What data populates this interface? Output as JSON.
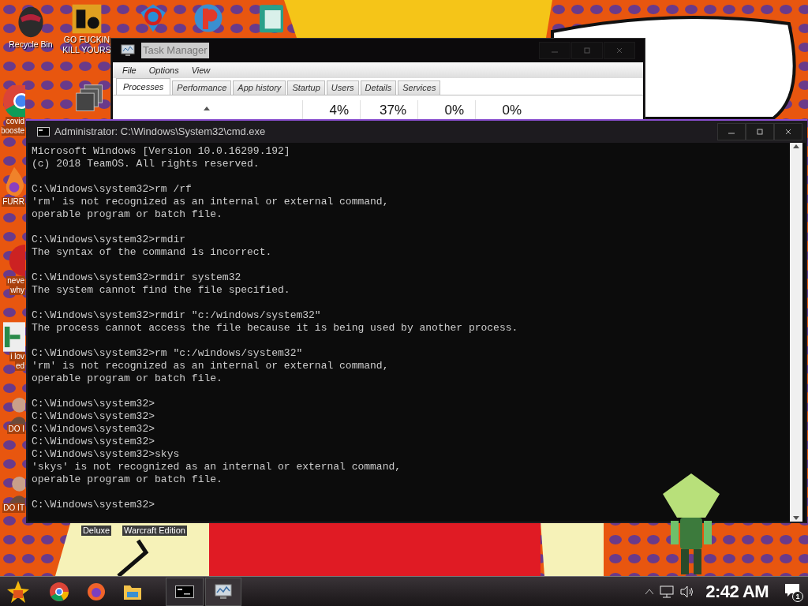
{
  "desktop_icons": [
    {
      "kind": "bin",
      "label_lines": [
        "Recycle Bin"
      ]
    },
    {
      "kind": "de",
      "label_lines": [
        "GO FUCKIN",
        "KILL YOURS"
      ]
    },
    {
      "kind": "gem"
    },
    {
      "kind": "p"
    },
    {
      "kind": "doc"
    },
    {
      "kind": "chrome",
      "label_lines": [
        "covid",
        "booste"
      ]
    },
    {
      "kind": "stack"
    },
    {
      "kind": "fox",
      "label_lines": [
        "FURR"
      ]
    },
    {
      "kind": "dc",
      "label_lines": [
        "neve",
        "why"
      ]
    },
    {
      "kind": "h",
      "label_lines": [
        "i lov",
        "ed"
      ]
    },
    {
      "kind": "person",
      "label_lines": [
        "DO I"
      ]
    },
    {
      "kind": "person",
      "label_lines": [
        "DO IT"
      ]
    },
    {
      "kind": "none",
      "label_lines": [
        "Deluxe"
      ]
    },
    {
      "kind": "none",
      "label_lines": [
        "Warcraft Edition"
      ]
    }
  ],
  "task_manager": {
    "title": "Task Manager",
    "menu": [
      "File",
      "Options",
      "View"
    ],
    "tabs": [
      {
        "label": "Processes",
        "selected": true
      },
      {
        "label": "Performance",
        "selected": false
      },
      {
        "label": "App history",
        "selected": false
      },
      {
        "label": "Startup",
        "selected": false
      },
      {
        "label": "Users",
        "selected": false
      },
      {
        "label": "Details",
        "selected": false
      },
      {
        "label": "Services",
        "selected": false
      }
    ],
    "column_values": [
      "4%",
      "37%",
      "0%",
      "0%"
    ]
  },
  "cmd": {
    "title": "Administrator: C:\\Windows\\System32\\cmd.exe",
    "blocks": [
      [
        "Microsoft Windows [Version 10.0.16299.192]",
        "(c) 2018 TeamOS. All rights reserved."
      ],
      [
        "C:\\Windows\\system32>rm /rf",
        "'rm' is not recognized as an internal or external command,",
        "operable program or batch file."
      ],
      [
        "C:\\Windows\\system32>rmdir",
        "The syntax of the command is incorrect."
      ],
      [
        "C:\\Windows\\system32>rmdir system32",
        "The system cannot find the file specified."
      ],
      [
        "C:\\Windows\\system32>rmdir \"c:/windows/system32\"",
        "The process cannot access the file because it is being used by another process."
      ],
      [
        "C:\\Windows\\system32>rm \"c:/windows/system32\"",
        "'rm' is not recognized as an internal or external command,",
        "operable program or batch file."
      ],
      [
        "C:\\Windows\\system32>",
        "C:\\Windows\\system32>",
        "C:\\Windows\\system32>",
        "C:\\Windows\\system32>",
        "C:\\Windows\\system32>skys",
        "'skys' is not recognized as an internal or external command,",
        "operable program or batch file."
      ],
      [
        "C:\\Windows\\system32>"
      ]
    ]
  },
  "taskbar": {
    "time": "2:42 AM",
    "notification_count": "1"
  }
}
